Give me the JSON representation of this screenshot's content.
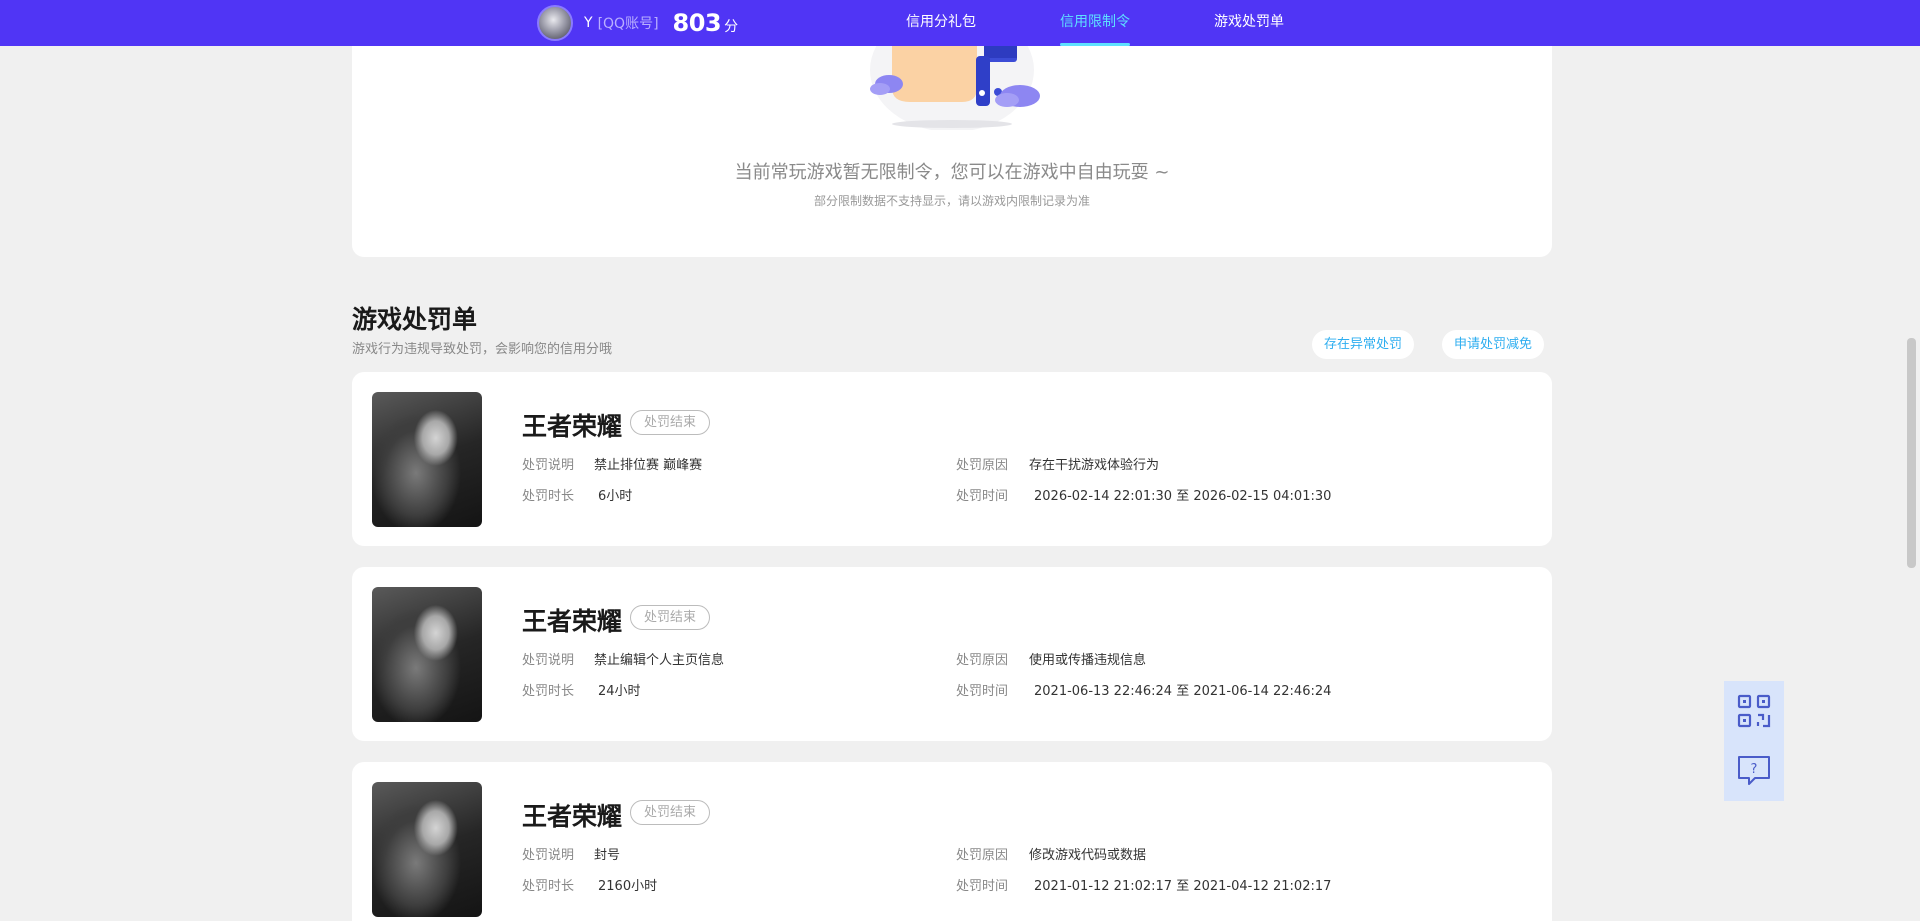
{
  "header": {
    "username": "Y",
    "account_type": "[QQ账号]",
    "score": "803",
    "score_unit": "分",
    "tabs": [
      {
        "label": "信用分礼包"
      },
      {
        "label": "信用限制令"
      },
      {
        "label": "游戏处罚单"
      }
    ]
  },
  "restriction": {
    "empty_message": "当前常玩游戏暂无限制令，您可以在游戏中自由玩耍 ~",
    "empty_sub": "部分限制数据不支持显示，请以游戏内限制记录为准"
  },
  "penalty_section": {
    "title": "游戏处罚单",
    "subtitle": "游戏行为违规导致处罚，会影响您的信用分哦",
    "abnormal_button": "存在异常处罚",
    "appeal_button": "申请处罚减免"
  },
  "field_labels": {
    "desc": "处罚说明",
    "reason": "处罚原因",
    "duration": "处罚时长",
    "time": "处罚时间"
  },
  "penalties": [
    {
      "game": "王者荣耀",
      "status": "处罚结束",
      "desc": "禁止排位赛 巅峰赛",
      "reason": "存在干扰游戏体验行为",
      "duration": "6小时",
      "time": "2026-02-14 22:01:30 至 2026-02-15 04:01:30"
    },
    {
      "game": "王者荣耀",
      "status": "处罚结束",
      "desc": "禁止编辑个人主页信息",
      "reason": "使用或传播违规信息",
      "duration": "24小时",
      "time": "2021-06-13 22:46:24 至 2021-06-14 22:46:24"
    },
    {
      "game": "王者荣耀",
      "status": "处罚结束",
      "desc": "封号",
      "reason": "修改游戏代码或数据",
      "duration": "2160小时",
      "time": "2021-01-12 21:02:17 至 2021-04-12 21:02:17"
    }
  ],
  "floating": {
    "qr_icon": "qr-code-icon",
    "help_icon": "question-bubble-icon"
  },
  "colors": {
    "nav_bg": "#5035f5",
    "active_tab": "#5ee0ff",
    "link": "#2eaef0"
  }
}
